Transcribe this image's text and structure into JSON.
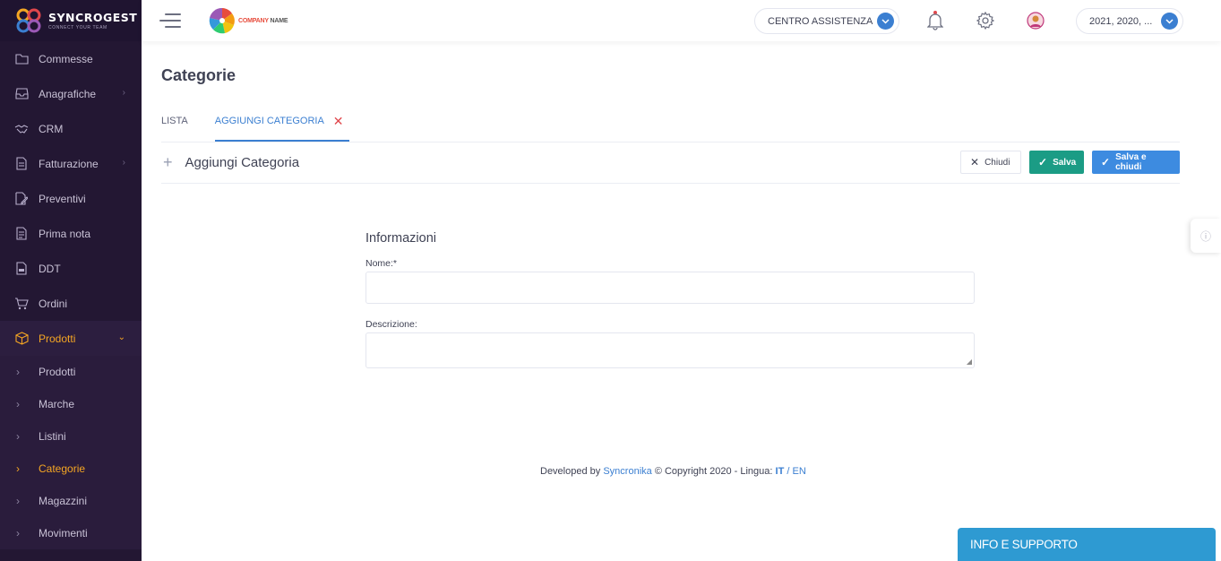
{
  "brand": {
    "name": "SYNCROGEST",
    "tagline": "CONNECT YOUR TEAM"
  },
  "sidebar": {
    "items": [
      {
        "label": "Commesse",
        "icon": "folder-icon"
      },
      {
        "label": "Anagrafiche",
        "icon": "inbox-icon",
        "arrow": "›"
      },
      {
        "label": "CRM",
        "icon": "handshake-icon"
      },
      {
        "label": "Fatturazione",
        "icon": "document-icon",
        "arrow": "›"
      },
      {
        "label": "Preventivi",
        "icon": "edit-document-icon"
      },
      {
        "label": "Prima nota",
        "icon": "note-icon"
      },
      {
        "label": "DDT",
        "icon": "ddt-icon"
      },
      {
        "label": "Ordini",
        "icon": "cart-icon"
      },
      {
        "label": "Prodotti",
        "icon": "box-icon",
        "arrow": "⌄"
      }
    ],
    "sub_items": [
      "Prodotti",
      "Marche",
      "Listini",
      "Categorie",
      "Magazzini",
      "Movimenti"
    ],
    "active_sub": "Categorie"
  },
  "header": {
    "company_logo_text": {
      "company": "COMPANY",
      "name": "NAME"
    },
    "support": "CENTRO ASSISTENZA",
    "years": "2021, 2020, ..."
  },
  "page": {
    "title": "Categorie",
    "tabs": [
      {
        "label": "LISTA"
      },
      {
        "label": "AGGIUNGI CATEGORIA",
        "close": "✕"
      }
    ],
    "toolbar_title": "Aggiungi Categoria",
    "buttons": {
      "close": "Chiudi",
      "save": "Salva",
      "save_close": "Salva e chiudi"
    }
  },
  "form": {
    "section_title": "Informazioni",
    "name_label": "Nome:*",
    "name_value": "",
    "description_label": "Descrizione:",
    "description_value": ""
  },
  "footer": {
    "developed_by": "Developed by",
    "company": "Syncronika",
    "copyright": "© Copyright 2020 - Lingua:",
    "lang_it": "IT",
    "separator": "/",
    "lang_en": "EN"
  },
  "support_widget": {
    "label": "INFO E SUPPORTO"
  },
  "colors": {
    "sidebar_bg": "#231733",
    "accent_orange": "#f5a623",
    "primary_blue": "#3b7fd1",
    "save_green": "#1b9c85",
    "widget_blue": "#2e9ad2"
  }
}
